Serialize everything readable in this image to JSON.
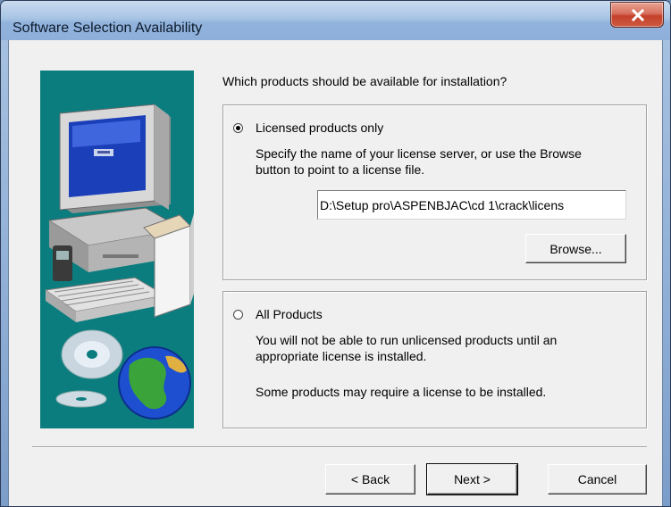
{
  "window": {
    "title": "Software Selection Availability"
  },
  "question": "Which products should be available for installation?",
  "licensed_option": {
    "label": "Licensed products only",
    "selected": true,
    "description": [
      "Specify the name of your license server, or use the Browse",
      "button to point to a license file."
    ],
    "license_path": "D:\\Setup pro\\ASPENBJAC\\cd 1\\crack\\licens",
    "browse_label": "Browse..."
  },
  "all_option": {
    "label": "All Products",
    "selected": false,
    "description": [
      "You will not be able to run unlicensed products until an",
      "appropriate license is installed."
    ],
    "note": "Some products may require a license to be installed."
  },
  "buttons": {
    "back": "< Back",
    "next": "Next >",
    "cancel": "Cancel"
  },
  "icons": {
    "close": "close-icon",
    "illustration": "computer-cd-globe-illustration"
  },
  "colors": {
    "illustration_bg": "#0c7d7f",
    "dialog_bg": "#f0f0f0",
    "close_button": "#c4412a"
  }
}
